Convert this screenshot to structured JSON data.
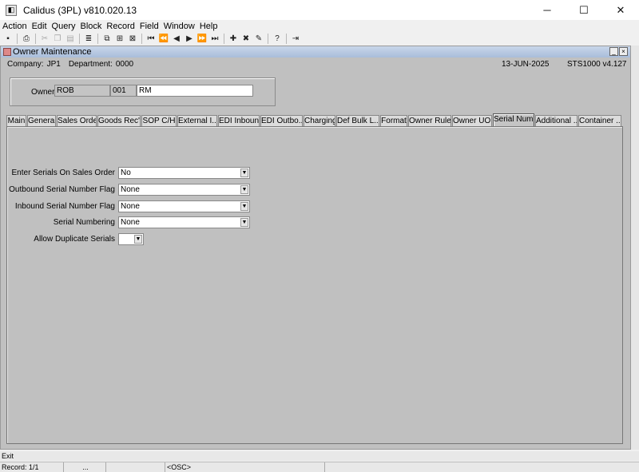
{
  "window": {
    "title": "Calidus (3PL) v810.020.13",
    "controls": [
      "─",
      "☐",
      "✕"
    ]
  },
  "menu": [
    "Action",
    "Edit",
    "Query",
    "Block",
    "Record",
    "Field",
    "Window",
    "Help"
  ],
  "form": {
    "title": "Owner Maintenance",
    "company_label": "Company:",
    "company": "JP1",
    "department_label": "Department:",
    "department": "0000",
    "date": "13-JUN-2025",
    "version": "STS1000  v4.127",
    "controls": [
      "_",
      "×"
    ]
  },
  "owner": {
    "label": "Owner",
    "code": "ROB",
    "number": "001",
    "name": "RM"
  },
  "tabs": [
    "Main",
    "General",
    "Sales Order",
    "Goods Rec'd",
    "SOP C/H",
    "External I...",
    "EDI Inbound",
    "EDI Outbo...",
    "Charging",
    "Def Bulk L...",
    "Format",
    "Owner Rules",
    "Owner UOM",
    "Serial Num...",
    "Additional ...",
    "Container ..."
  ],
  "active_tab": "Serial Num...",
  "fields": [
    {
      "label": "Enter Serials On Sales Order",
      "value": "No"
    },
    {
      "label": "Outbound Serial Number Flag",
      "value": "None"
    },
    {
      "label": "Inbound Serial Number Flag",
      "value": "None"
    },
    {
      "label": "Serial Numbering",
      "value": "None"
    },
    {
      "label": "Allow Duplicate Serials",
      "value": ""
    }
  ],
  "status": {
    "message": "Exit",
    "record": "Record: 1/1",
    "ellipsis": "...",
    "osc": "<OSC>"
  }
}
